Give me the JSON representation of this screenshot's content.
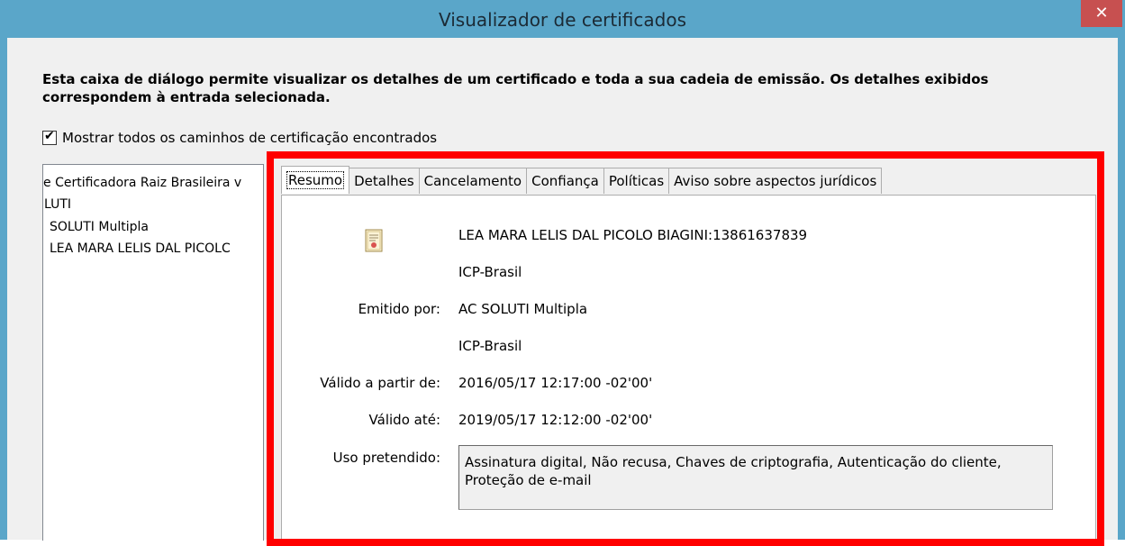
{
  "window": {
    "title": "Visualizador de certificados",
    "close_glyph": "✕"
  },
  "intro_text": "Esta caixa de diálogo permite visualizar os detalhes de um certificado e toda a sua cadeia de emissão. Os detalhes exibidos correspondem à entrada selecionada.",
  "show_all_paths": {
    "label": "Mostrar todos os caminhos de certificação encontrados",
    "checked": true,
    "check_glyph": "✔"
  },
  "chain": [
    {
      "label": "e Certificadora Raiz Brasileira v"
    },
    {
      "label": "LUTI"
    },
    {
      "label": "SOLUTI Multipla"
    },
    {
      "label": "LEA MARA LELIS DAL PICOLC"
    }
  ],
  "tabs": [
    {
      "label": "Resumo"
    },
    {
      "label": "Detalhes"
    },
    {
      "label": "Cancelamento"
    },
    {
      "label": "Confiança"
    },
    {
      "label": "Políticas"
    },
    {
      "label": "Aviso sobre aspectos jurídicos"
    }
  ],
  "summary": {
    "subject_name": "LEA MARA LELIS DAL PICOLO BIAGINI:13861637839",
    "subject_org": "ICP-Brasil",
    "issued_by_label": "Emitido por:",
    "issuer_name": "AC SOLUTI Multipla",
    "issuer_org": "ICP-Brasil",
    "valid_from_label": "Válido a partir de:",
    "valid_from": "2016/05/17 12:17:00 -02'00'",
    "valid_to_label": "Válido até:",
    "valid_to": "2019/05/17 12:12:00 -02'00'",
    "usage_label": "Uso pretendido:",
    "usage_value": "Assinatura digital, Não recusa, Chaves de criptografia, Autenticação do cliente, Proteção de e-mail"
  },
  "colors": {
    "titlebar": "#5aa6c9",
    "close": "#c75050",
    "highlight": "#ff0000"
  },
  "icons": {
    "certificate": "certificate-icon"
  }
}
